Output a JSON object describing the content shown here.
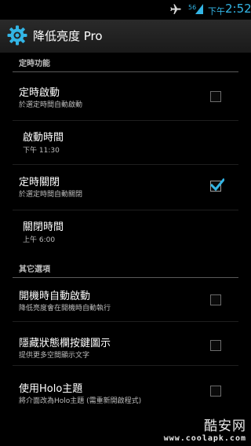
{
  "status_bar": {
    "network_label": "56",
    "ampm": "下午",
    "time": "2:52",
    "plane_icon": "airplane-icon",
    "signal_icon": "signal-icon",
    "accent_color": "#33b5e5"
  },
  "action_bar": {
    "title": "降低亮度 Pro",
    "icon": "gear-icon"
  },
  "sections": [
    {
      "header": "定時功能",
      "items": [
        {
          "title": "定時啟動",
          "summary": "於選定時間自動啟動",
          "checkbox": true,
          "checked": false
        },
        {
          "title": "啟動時間",
          "summary": "下午 11:30",
          "checkbox": false
        },
        {
          "title": "定時關閉",
          "summary": "於選定時間自動關閉",
          "checkbox": true,
          "checked": true
        },
        {
          "title": "關閉時間",
          "summary": "上午 6:00",
          "checkbox": false
        }
      ]
    },
    {
      "header": "其它選項",
      "items": [
        {
          "title": "開機時自動啟動",
          "summary": "降低亮度會在開機時自動執行",
          "checkbox": true,
          "checked": false
        },
        {
          "title": "隱藏狀態欄按鍵圖示",
          "summary": "提供更多空間顯示文字",
          "checkbox": true,
          "checked": false
        },
        {
          "title": "使用Holo主題",
          "summary": "將介面改為Holo主題 (需重新開啟程式)",
          "checkbox": true,
          "checked": false
        }
      ]
    }
  ],
  "watermark": {
    "name": "酷安网",
    "url": "www.coolapk.com"
  },
  "colors": {
    "background": "#000000",
    "accent": "#33b5e5",
    "summary_text": "#bdbdbd"
  }
}
